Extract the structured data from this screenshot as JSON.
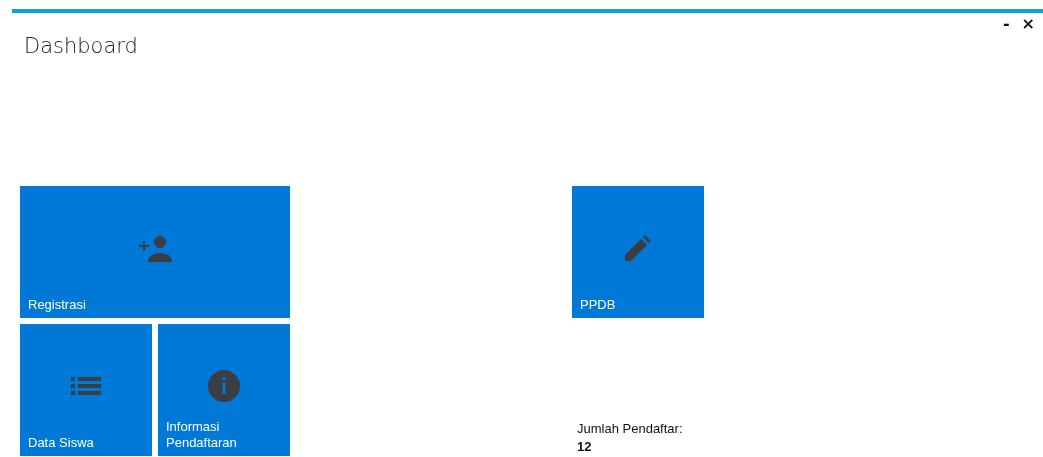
{
  "window": {
    "title": "Dashboard",
    "minimize_button": "-",
    "close_button": "×"
  },
  "tile_groups": [
    {
      "tiles": [
        {
          "label": "Registrasi",
          "kind": "add-person",
          "wide": true
        },
        {
          "label": "Data Siswa",
          "kind": "list",
          "wide": false
        },
        {
          "label": "Informasi Pendaftaran",
          "kind": "info",
          "wide": false
        }
      ]
    },
    {
      "tiles": [
        {
          "label": "PPDB",
          "kind": "pencil",
          "wide": false
        }
      ]
    }
  ],
  "registrant_count": {
    "label": "Jumlah Pendaftar:",
    "value": "12"
  }
}
